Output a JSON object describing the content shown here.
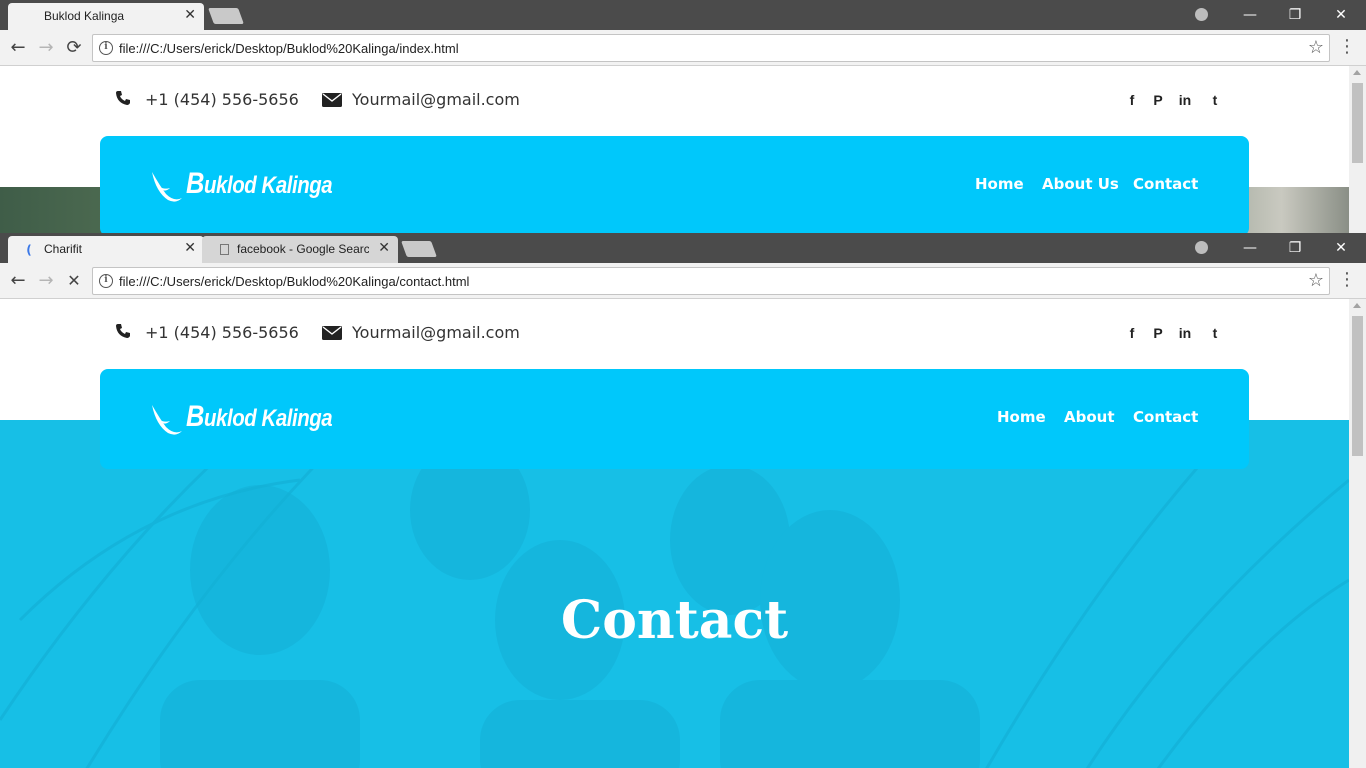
{
  "window1": {
    "tabs": [
      {
        "title": "Buklod Kalinga",
        "close": "✕",
        "favicon": "page-icon"
      }
    ],
    "url": "file:///C:/Users/erick/Desktop/Buklod%20Kalinga/index.html",
    "reload_icon": "⟳",
    "contact": {
      "phone": "+1 (454) 556-5656",
      "email": "Yourmail@gmail.com"
    },
    "logo_first": "B",
    "logo_rest": "uklod Kalinga",
    "nav": {
      "home": "Home",
      "about": "About Us",
      "contact": "Contact"
    }
  },
  "window2": {
    "tabs": [
      {
        "title": "Charifit",
        "close": "✕",
        "favicon": "loading-spinner-icon"
      },
      {
        "title": "facebook - Google Searc",
        "close": "✕",
        "favicon": "page-icon"
      }
    ],
    "url": "file:///C:/Users/erick/Desktop/Buklod%20Kalinga/contact.html",
    "stop_icon": "✕",
    "contact": {
      "phone": "+1 (454) 556-5656",
      "email": "Yourmail@gmail.com"
    },
    "logo_first": "B",
    "logo_rest": "uklod Kalinga",
    "nav": {
      "home": "Home",
      "about": "About",
      "contact": "Contact"
    },
    "hero_title": "Contact"
  },
  "social": {
    "facebook": "f",
    "pinterest": "P",
    "linkedin": "in",
    "twitter": "t"
  },
  "controls": {
    "back": "←",
    "forward": "→",
    "star": "☆",
    "menu": "⋮",
    "minimize": "—",
    "maximize": "❐",
    "close": "✕"
  },
  "colors": {
    "brand": "#00c8fb",
    "hero": "#17bfe6",
    "tabbar": "#4b4b4b"
  }
}
